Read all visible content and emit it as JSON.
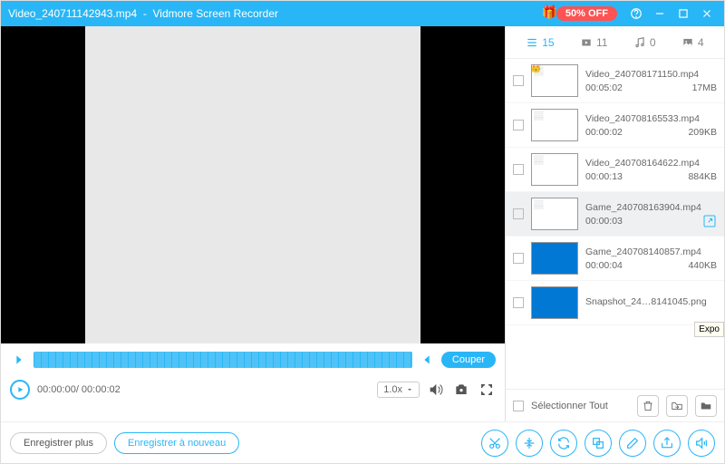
{
  "titlebar": {
    "filename": "Video_240711142943.mp4",
    "separator": "-",
    "appname": "Vidmore Screen Recorder",
    "promo": "50% OFF"
  },
  "tabs": {
    "list_count": 15,
    "video_count": 11,
    "audio_count": 0,
    "image_count": 4
  },
  "files": [
    {
      "name": "Video_240708171150.mp4",
      "duration": "00:05:02",
      "size": "17MB",
      "thumb": "doc",
      "crown": true
    },
    {
      "name": "Video_240708165533.mp4",
      "duration": "00:00:02",
      "size": "209KB",
      "thumb": "doc"
    },
    {
      "name": "Video_240708164622.mp4",
      "duration": "00:00:13",
      "size": "884KB",
      "thumb": "doc"
    },
    {
      "name": "Game_240708163904.mp4",
      "duration": "00:00:03",
      "size": "",
      "thumb": "doc",
      "selected": true,
      "export": true
    },
    {
      "name": "Game_240708140857.mp4",
      "duration": "00:00:04",
      "size": "440KB",
      "thumb": "desk"
    },
    {
      "name": "Snapshot_24…8141045.png",
      "duration": "",
      "size": "",
      "thumb": "desk"
    }
  ],
  "player": {
    "cut_label": "Couper",
    "timecode": "00:00:00/ 00:00:02",
    "speed": "1.0x"
  },
  "selall": {
    "label": "Sélectionner Tout"
  },
  "footer": {
    "record_more": "Enregistrer plus",
    "record_again": "Enregistrer à nouveau"
  },
  "tooltip": "Expo"
}
